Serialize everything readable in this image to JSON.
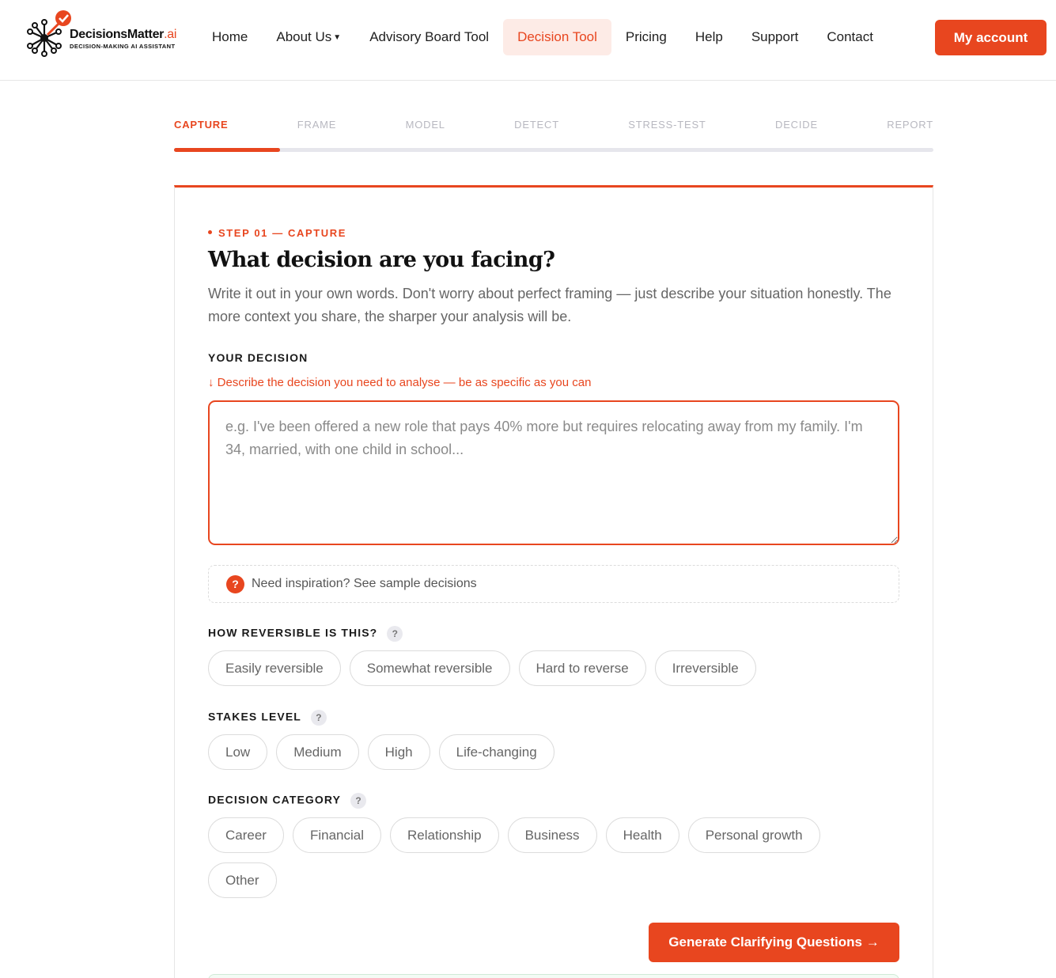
{
  "brand": {
    "name": "DecisionsMatter",
    "name_suffix": ".ai",
    "tagline": "DECISION-MAKING AI ASSISTANT",
    "accent_color": "#e8461f"
  },
  "nav": {
    "items": [
      {
        "label": "Home"
      },
      {
        "label": "About Us"
      },
      {
        "label": "Advisory Board Tool"
      },
      {
        "label": "Decision Tool",
        "active": true
      },
      {
        "label": "Pricing"
      },
      {
        "label": "Help"
      },
      {
        "label": "Support"
      },
      {
        "label": "Contact"
      }
    ],
    "account_label": "My account"
  },
  "steps": {
    "items": [
      "CAPTURE",
      "FRAME",
      "MODEL",
      "DETECT",
      "STRESS-TEST",
      "DECIDE",
      "REPORT"
    ],
    "active_index": 0,
    "progress_fraction": 0.14
  },
  "capture": {
    "eyebrow": "STEP 01 — CAPTURE",
    "title": "What decision are you facing?",
    "subtitle": "Write it out in your own words. Don't worry about perfect framing — just describe your situation honestly. The more context you share, the sharper your analysis will be.",
    "decision_label": "YOUR DECISION",
    "decision_hint": "↓ Describe the decision you need to analyse — be as specific as you can",
    "decision_placeholder": "e.g. I've been offered a new role that pays 40% more but requires relocating away from my family. I'm 34, married, with one child in school...",
    "decision_value": "",
    "inspiration_icon": "?",
    "inspiration_text": "Need inspiration? See sample decisions",
    "reversibility_label": "HOW REVERSIBLE IS THIS?",
    "reversibility_options": [
      "Easily reversible",
      "Somewhat reversible",
      "Hard to reverse",
      "Irreversible"
    ],
    "stakes_label": "STAKES LEVEL",
    "stakes_options": [
      "Low",
      "Medium",
      "High",
      "Life-changing"
    ],
    "category_label": "DECISION CATEGORY",
    "category_options": [
      "Career",
      "Financial",
      "Relationship",
      "Business",
      "Health",
      "Personal growth",
      "Other"
    ],
    "help_glyph": "?",
    "generate_label": "Generate Clarifying Questions →"
  }
}
